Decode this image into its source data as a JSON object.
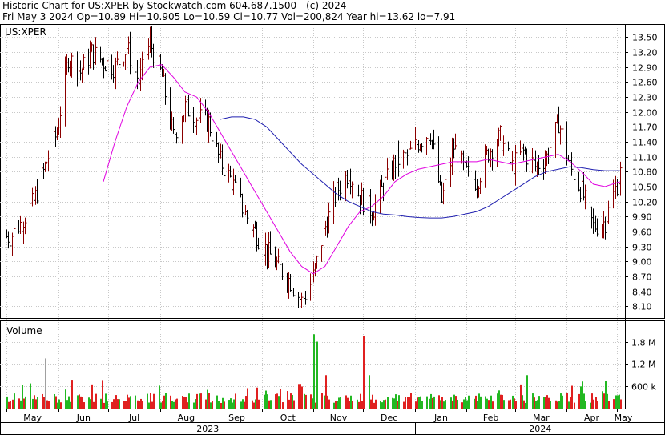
{
  "header": {
    "line1": "Historic Chart for US:XPER by Stockwatch.com 604.687.1500 - (c) 2024",
    "line2": "Fri May  3 2024   Op=10.89  Hi=10.905  Lo=10.59  Cl=10.77  Vol=200,824  Year hi=13.62  lo=7.91"
  },
  "symbol_label": "US:XPER",
  "volume_label": "Volume",
  "colors": {
    "up_bar": "#8b0000",
    "down_bar": "#000000",
    "ma_short": "#e000e0",
    "ma_long": "#2020b0",
    "vol_up": "#22b822",
    "vol_down": "#e02020",
    "vol_neutral": "#a0a0a0",
    "grid": "#c8c8c8"
  },
  "chart_data": [
    {
      "type": "line",
      "title": "Historic Chart for US:XPER",
      "description_series": "OHLC price bars with moving averages",
      "y_ticks": [
        "13.50",
        "13.20",
        "12.90",
        "12.60",
        "12.30",
        "12.00",
        "11.70",
        "11.40",
        "11.10",
        "10.80",
        "10.50",
        "10.20",
        "9.90",
        "9.60",
        "9.30",
        "9.00",
        "8.70",
        "8.40",
        "8.10"
      ],
      "ylim": [
        7.91,
        13.62
      ],
      "x_ticks": [
        "May",
        "Jun",
        "Jul",
        "Aug",
        "Sep",
        "Oct",
        "Nov",
        "Dec",
        "Jan",
        "Feb",
        "Mar",
        "Apr",
        "May"
      ],
      "x_years": [
        "2023",
        "2024"
      ],
      "grid": true,
      "series": [
        {
          "kind": "close",
          "points": [
            [
              "2023-05-03",
              9.5
            ],
            [
              "2023-05-10",
              9.8
            ],
            [
              "2023-05-17",
              10.2
            ],
            [
              "2023-05-24",
              10.9
            ],
            [
              "2023-05-31",
              11.6
            ],
            [
              "2023-06-07",
              13.1
            ],
            [
              "2023-06-14",
              12.8
            ],
            [
              "2023-06-21",
              13.2
            ],
            [
              "2023-06-28",
              13.0
            ],
            [
              "2023-07-05",
              12.9
            ],
            [
              "2023-07-12",
              13.3
            ],
            [
              "2023-07-19",
              12.6
            ],
            [
              "2023-07-26",
              13.4
            ],
            [
              "2023-08-02",
              12.7
            ],
            [
              "2023-08-09",
              11.5
            ],
            [
              "2023-08-16",
              12.1
            ],
            [
              "2023-08-23",
              11.9
            ],
            [
              "2023-08-30",
              11.8
            ],
            [
              "2023-09-06",
              11.0
            ],
            [
              "2023-09-13",
              10.6
            ],
            [
              "2023-09-20",
              10.0
            ],
            [
              "2023-09-27",
              9.6
            ],
            [
              "2023-10-04",
              9.2
            ],
            [
              "2023-10-11",
              8.9
            ],
            [
              "2023-10-18",
              8.6
            ],
            [
              "2023-10-25",
              8.2
            ],
            [
              "2023-11-01",
              8.7
            ],
            [
              "2023-11-08",
              9.7
            ],
            [
              "2023-11-15",
              10.4
            ],
            [
              "2023-11-22",
              10.8
            ],
            [
              "2023-11-29",
              10.3
            ],
            [
              "2023-12-06",
              10.0
            ],
            [
              "2023-12-13",
              10.5
            ],
            [
              "2023-12-20",
              11.0
            ],
            [
              "2023-12-27",
              11.1
            ],
            [
              "2024-01-03",
              11.4
            ],
            [
              "2024-01-10",
              11.6
            ],
            [
              "2024-01-17",
              10.2
            ],
            [
              "2024-01-24",
              11.3
            ],
            [
              "2024-01-31",
              10.8
            ],
            [
              "2024-02-07",
              10.6
            ],
            [
              "2024-02-14",
              11.2
            ],
            [
              "2024-02-21",
              11.5
            ],
            [
              "2024-02-28",
              10.9
            ],
            [
              "2024-03-06",
              11.2
            ],
            [
              "2024-03-13",
              10.9
            ],
            [
              "2024-03-20",
              11.1
            ],
            [
              "2024-03-27",
              11.8
            ],
            [
              "2024-04-03",
              10.9
            ],
            [
              "2024-04-10",
              10.4
            ],
            [
              "2024-04-17",
              9.7
            ],
            [
              "2024-04-24",
              9.8
            ],
            [
              "2024-05-03",
              10.77
            ]
          ]
        },
        {
          "kind": "ma_short",
          "points": [
            [
              "2023-06-28",
              10.6
            ],
            [
              "2023-07-05",
              11.4
            ],
            [
              "2023-07-12",
              12.1
            ],
            [
              "2023-07-19",
              12.6
            ],
            [
              "2023-07-26",
              12.9
            ],
            [
              "2023-08-02",
              12.95
            ],
            [
              "2023-08-09",
              12.7
            ],
            [
              "2023-08-16",
              12.4
            ],
            [
              "2023-08-23",
              12.3
            ],
            [
              "2023-08-30",
              12.0
            ],
            [
              "2023-09-06",
              11.6
            ],
            [
              "2023-09-13",
              11.2
            ],
            [
              "2023-09-20",
              10.8
            ],
            [
              "2023-09-27",
              10.4
            ],
            [
              "2023-10-04",
              10.0
            ],
            [
              "2023-10-11",
              9.6
            ],
            [
              "2023-10-18",
              9.2
            ],
            [
              "2023-10-25",
              8.9
            ],
            [
              "2023-11-01",
              8.75
            ],
            [
              "2023-11-08",
              8.9
            ],
            [
              "2023-11-15",
              9.3
            ],
            [
              "2023-11-22",
              9.7
            ],
            [
              "2023-11-29",
              10.0
            ],
            [
              "2023-12-06",
              10.1
            ],
            [
              "2023-12-13",
              10.3
            ],
            [
              "2023-12-20",
              10.6
            ],
            [
              "2023-12-27",
              10.75
            ],
            [
              "2024-01-03",
              10.85
            ],
            [
              "2024-01-10",
              10.9
            ],
            [
              "2024-01-17",
              10.95
            ],
            [
              "2024-01-24",
              11.0
            ],
            [
              "2024-01-31",
              11.0
            ],
            [
              "2024-02-07",
              11.0
            ],
            [
              "2024-02-14",
              11.05
            ],
            [
              "2024-02-21",
              11.0
            ],
            [
              "2024-02-28",
              10.95
            ],
            [
              "2024-03-06",
              11.0
            ],
            [
              "2024-03-13",
              11.05
            ],
            [
              "2024-03-20",
              11.1
            ],
            [
              "2024-03-27",
              11.15
            ],
            [
              "2024-04-03",
              11.0
            ],
            [
              "2024-04-10",
              10.8
            ],
            [
              "2024-04-17",
              10.55
            ],
            [
              "2024-04-24",
              10.5
            ],
            [
              "2024-05-03",
              10.6
            ]
          ]
        },
        {
          "kind": "ma_long",
          "points": [
            [
              "2023-09-06",
              11.85
            ],
            [
              "2023-09-13",
              11.9
            ],
            [
              "2023-09-20",
              11.9
            ],
            [
              "2023-09-27",
              11.85
            ],
            [
              "2023-10-04",
              11.7
            ],
            [
              "2023-10-11",
              11.45
            ],
            [
              "2023-10-18",
              11.2
            ],
            [
              "2023-10-25",
              10.95
            ],
            [
              "2023-11-01",
              10.75
            ],
            [
              "2023-11-08",
              10.55
            ],
            [
              "2023-11-15",
              10.35
            ],
            [
              "2023-11-22",
              10.2
            ],
            [
              "2023-11-29",
              10.1
            ],
            [
              "2023-12-06",
              10.0
            ],
            [
              "2023-12-13",
              9.95
            ],
            [
              "2023-12-20",
              9.93
            ],
            [
              "2023-12-27",
              9.9
            ],
            [
              "2024-01-03",
              9.88
            ],
            [
              "2024-01-10",
              9.87
            ],
            [
              "2024-01-17",
              9.87
            ],
            [
              "2024-01-24",
              9.9
            ],
            [
              "2024-01-31",
              9.95
            ],
            [
              "2024-02-07",
              10.0
            ],
            [
              "2024-02-14",
              10.1
            ],
            [
              "2024-02-21",
              10.25
            ],
            [
              "2024-02-28",
              10.4
            ],
            [
              "2024-03-06",
              10.55
            ],
            [
              "2024-03-13",
              10.7
            ],
            [
              "2024-03-20",
              10.8
            ],
            [
              "2024-03-27",
              10.85
            ],
            [
              "2024-04-03",
              10.9
            ],
            [
              "2024-04-10",
              10.88
            ],
            [
              "2024-04-17",
              10.84
            ],
            [
              "2024-04-24",
              10.82
            ],
            [
              "2024-05-03",
              10.82
            ]
          ]
        }
      ]
    },
    {
      "type": "bar",
      "title": "Volume",
      "y_ticks": [
        "1.8 M",
        "1.2 M",
        "600 k"
      ],
      "ylim": [
        0,
        2200000
      ],
      "spikes": [
        [
          "2023-05-24",
          1350000,
          "neutral"
        ],
        [
          "2023-06-21",
          650000,
          "down"
        ],
        [
          "2023-11-01",
          2000000,
          "up"
        ],
        [
          "2023-11-03",
          1800000,
          "up"
        ],
        [
          "2023-11-08",
          900000,
          "down"
        ],
        [
          "2023-12-01",
          1950000,
          "down"
        ],
        [
          "2023-12-04",
          900000,
          "up"
        ],
        [
          "2024-03-08",
          900000,
          "up"
        ]
      ],
      "typical_range": [
        150000,
        600000
      ]
    }
  ]
}
